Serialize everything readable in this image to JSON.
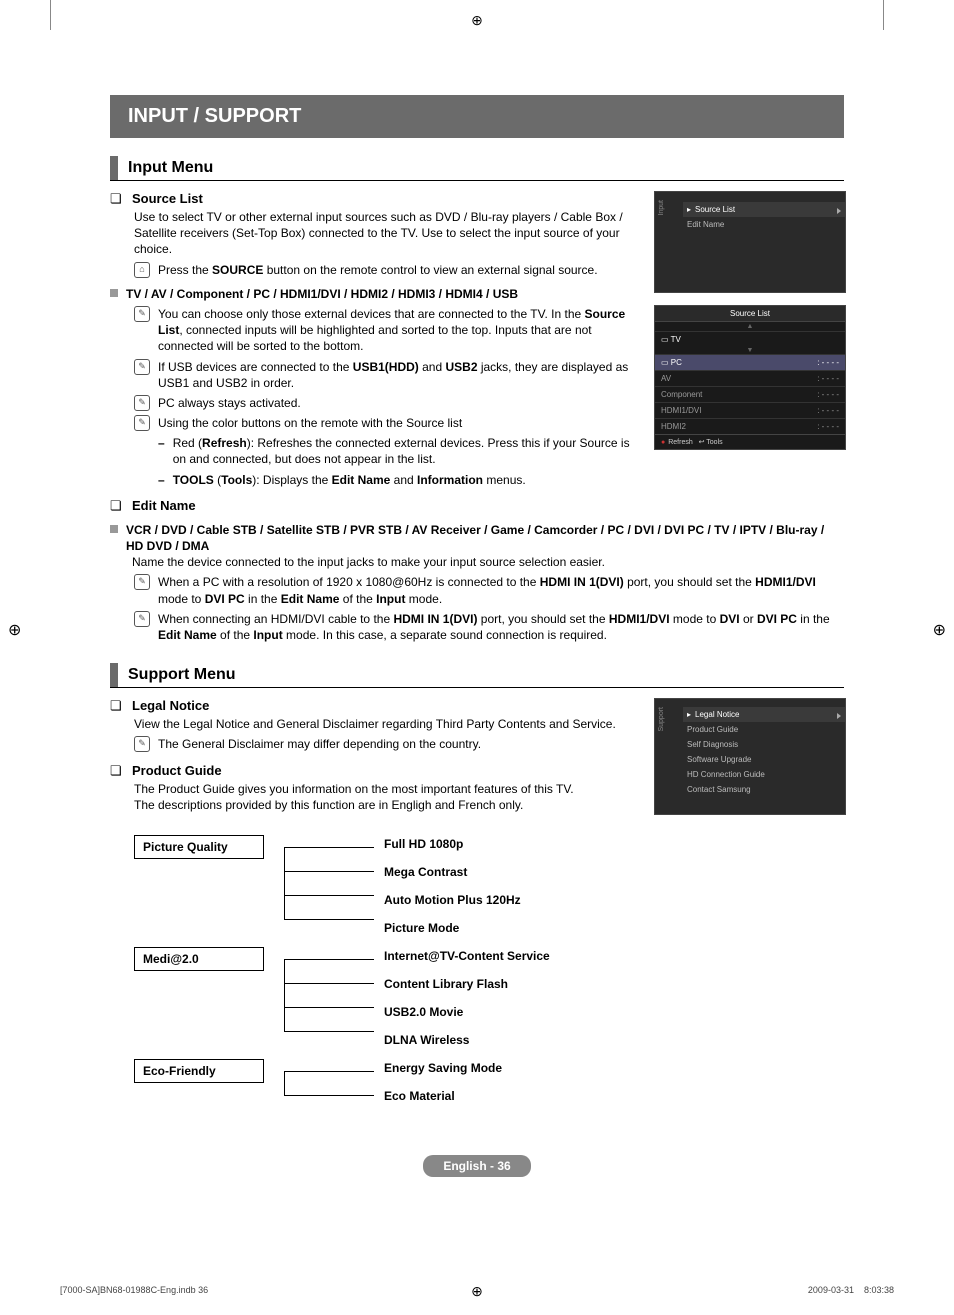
{
  "header_bar": "INPUT / SUPPORT",
  "sections": {
    "input_menu": "Input Menu",
    "support_menu": "Support Menu"
  },
  "input": {
    "source_list": {
      "title": "Source List",
      "body": "Use to select TV or other external input sources such as DVD / Blu-ray players / Cable Box / Satellite receivers (Set-Top Box) connected to the TV. Use to select the input source of your choice.",
      "press_pre": "Press the ",
      "press_bold": "SOURCE",
      "press_post": " button on the remote control to view an external signal source."
    },
    "tv_av": {
      "title": "TV / AV / Component / PC / HDMI1/DVI / HDMI2 / HDMI3 / HDMI4 / USB",
      "note1_a": "You can choose only those external devices that are connected to the TV. In the ",
      "note1_b": "Source List",
      "note1_c": ", connected inputs will be highlighted and sorted to the top. Inputs that are not connected will be sorted to the bottom.",
      "note2_a": "If USB devices are connected to the ",
      "note2_b": "USB1(HDD)",
      "note2_c": " and ",
      "note2_d": "USB2",
      "note2_e": " jacks, they are displayed as USB1 and USB2 in order.",
      "note3": "PC always stays activated.",
      "note4": "Using the color buttons on the remote with the Source list",
      "red_a": "Red (",
      "red_b": "Refresh",
      "red_c": "): Refreshes the connected external devices. Press this if your Source is on and connected, but does not appear in the list.",
      "tools_a": "TOOLS",
      "tools_b": " (",
      "tools_c": "Tools",
      "tools_d": "): Displays the ",
      "tools_e": "Edit Name",
      "tools_f": " and ",
      "tools_g": "Information",
      "tools_h": " menus."
    },
    "edit_name": {
      "title": "Edit Name",
      "devices": "VCR / DVD / Cable STB / Satellite STB / PVR STB / AV Receiver / Game / Camcorder / PC / DVI / DVI PC / TV / IPTV / Blu-ray / HD DVD / DMA",
      "body": "Name the device connected to the input jacks to make your input source selection easier.",
      "n1_a": "When a PC with a resolution of 1920 x 1080@60Hz is connected to the ",
      "n1_b": "HDMI IN 1(DVI)",
      "n1_c": " port, you should set the ",
      "n1_d": "HDMI1/DVI",
      "n1_e": " mode to ",
      "n1_f": "DVI PC",
      "n1_g": " in the ",
      "n1_h": "Edit Name",
      "n1_i": " of the ",
      "n1_j": "Input",
      "n1_k": " mode.",
      "n2_a": "When connecting an HDMI/DVI cable to the ",
      "n2_b": "HDMI IN 1(DVI)",
      "n2_c": " port, you should set the ",
      "n2_d": "HDMI1/DVI",
      "n2_e": " mode to ",
      "n2_f": "DVI",
      "n2_g": " or ",
      "n2_h": "DVI PC",
      "n2_i": " in the ",
      "n2_j": "Edit Name",
      "n2_k": " of the ",
      "n2_l": "Input",
      "n2_m": " mode. In this case, a separate sound connection is required."
    }
  },
  "support": {
    "legal": {
      "title": "Legal Notice",
      "body": "View the Legal Notice and General Disclaimer regarding Third Party Contents and Service.",
      "note": "The General Disclaimer may differ depending on the country."
    },
    "guide": {
      "title": "Product Guide",
      "body1": "The Product Guide gives you information on the most important features of this TV.",
      "body2": "The descriptions provided by this function are in Engligh and French only."
    }
  },
  "tree": {
    "pq": {
      "label": "Picture Quality",
      "items": [
        "Full HD 1080p",
        "Mega Contrast",
        "Auto Motion Plus 120Hz",
        "Picture Mode"
      ]
    },
    "media": {
      "label": "Medi@2.0",
      "items": [
        "Internet@TV-Content Service",
        "Content Library Flash",
        "USB2.0 Movie",
        "DLNA Wireless"
      ]
    },
    "eco": {
      "label": "Eco-Friendly",
      "items": [
        "Energy Saving Mode",
        "Eco Material"
      ]
    }
  },
  "osd_panels": {
    "input_menu": {
      "tab": "Input",
      "items": [
        "Source List",
        "Edit Name"
      ]
    },
    "source_list": {
      "title": "Source List",
      "rows": [
        {
          "name": "TV",
          "val": ""
        },
        {
          "name": "PC",
          "val": ": - - - -"
        },
        {
          "name": "AV",
          "val": ": - - - -"
        },
        {
          "name": "Component",
          "val": ": - - - -"
        },
        {
          "name": "HDMI1/DVI",
          "val": ": - - - -"
        },
        {
          "name": "HDMI2",
          "val": ": - - - -"
        }
      ],
      "footer_refresh": "Refresh",
      "footer_tools": "Tools"
    },
    "support_menu": {
      "tab": "Support",
      "items": [
        "Legal Notice",
        "Product Guide",
        "Self Diagnosis",
        "Software Upgrade",
        "HD Connection Guide",
        "Contact Samsung"
      ]
    }
  },
  "page_label": "English - 36",
  "footer_left": "[7000-SA]BN68-01988C-Eng.indb   36",
  "footer_right": "2009-03-31      8:03:38"
}
